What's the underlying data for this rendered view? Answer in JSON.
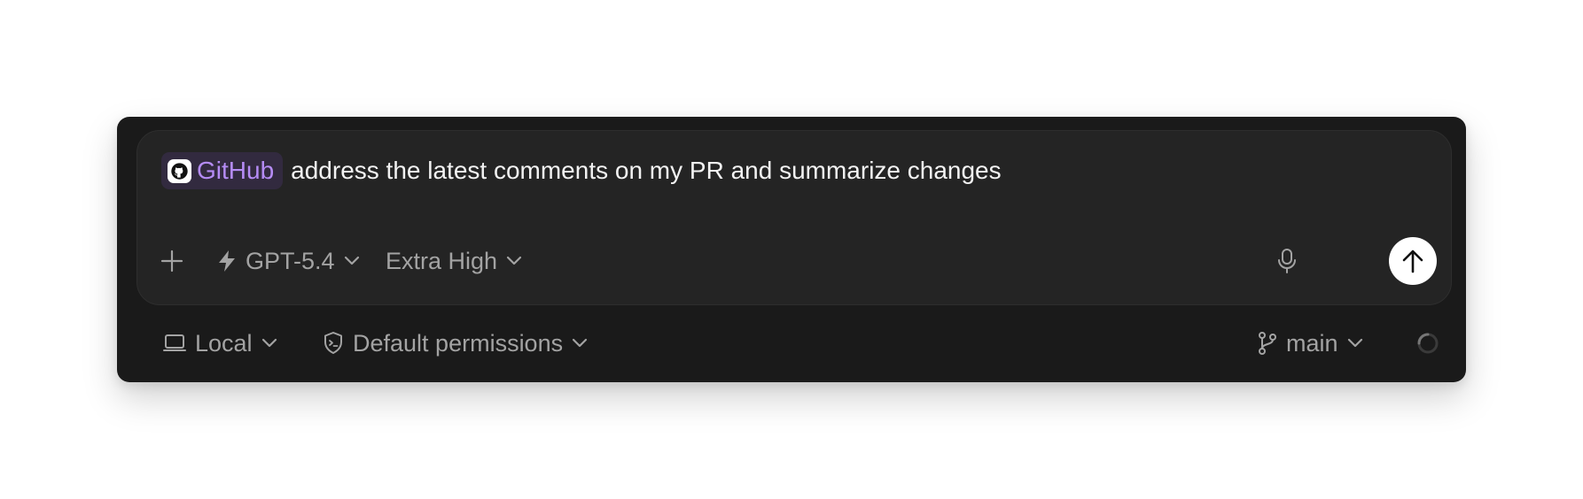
{
  "composer": {
    "mention": {
      "label": "GitHub",
      "icon": "github-icon"
    },
    "prompt_text": "address the latest comments on my PR and summarize changes"
  },
  "toolbar": {
    "add_icon": "plus-icon",
    "model": {
      "label": "GPT-5.4",
      "icon": "lightning-icon"
    },
    "reasoning": {
      "label": "Extra High"
    },
    "mic_icon": "microphone-icon",
    "send_icon": "arrow-up-icon"
  },
  "footer": {
    "environment": {
      "label": "Local",
      "icon": "laptop-icon"
    },
    "permissions": {
      "label": "Default permissions",
      "icon": "shield-terminal-icon"
    },
    "branch": {
      "label": "main",
      "icon": "git-branch-icon"
    },
    "status_icon": "loading-spinner-icon"
  },
  "colors": {
    "panel": "#1a1a1a",
    "composer": "#242424",
    "mention_bg": "#322a3f",
    "mention_text": "#b58cf5",
    "muted_text": "#a3a3a3",
    "prompt_text": "#f2f2f2"
  }
}
